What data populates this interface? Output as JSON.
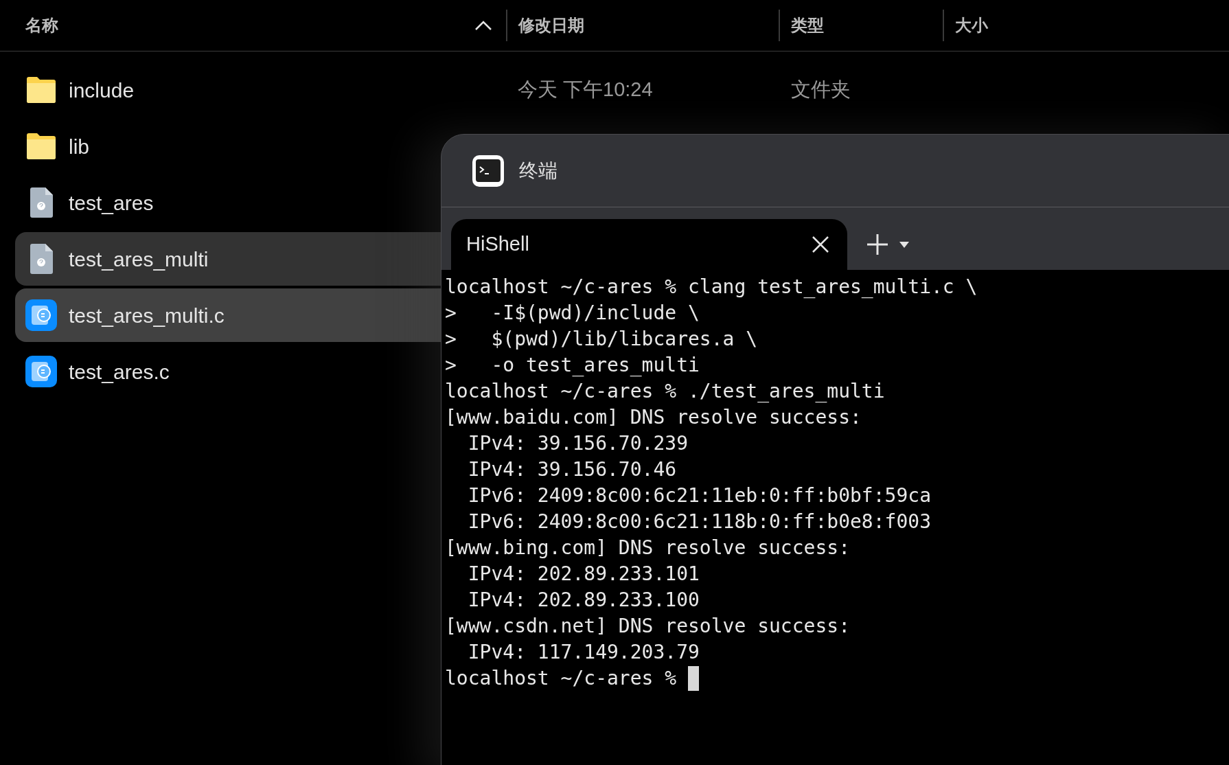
{
  "file_list": {
    "columns": [
      {
        "label": "名称",
        "sorted": true
      },
      {
        "label": "修改日期",
        "sorted": false
      },
      {
        "label": "类型",
        "sorted": false
      },
      {
        "label": "大小",
        "sorted": false
      }
    ],
    "rows": [
      {
        "name": "include",
        "kind": "folder",
        "selected": false,
        "modified": "今天 下午10:24",
        "type": "文件夹"
      },
      {
        "name": "lib",
        "kind": "folder",
        "selected": false
      },
      {
        "name": "test_ares",
        "kind": "binary",
        "selected": false
      },
      {
        "name": "test_ares_multi",
        "kind": "binary",
        "selected": true
      },
      {
        "name": "test_ares_multi.c",
        "kind": "source",
        "selected": true
      },
      {
        "name": "test_ares.c",
        "kind": "source",
        "selected": false
      }
    ]
  },
  "terminal": {
    "title": "终端",
    "tabs": [
      {
        "label": "HiShell",
        "selected": true
      }
    ],
    "lines": [
      "localhost ~/c-ares % clang test_ares_multi.c \\",
      ">   -I$(pwd)/include \\",
      ">   $(pwd)/lib/libcares.a \\",
      ">   -o test_ares_multi",
      "localhost ~/c-ares % ./test_ares_multi",
      "[www.baidu.com] DNS resolve success:",
      "  IPv4: 39.156.70.239",
      "  IPv4: 39.156.70.46",
      "  IPv6: 2409:8c00:6c21:11eb:0:ff:b0bf:59ca",
      "  IPv6: 2409:8c00:6c21:118b:0:ff:b0e8:f003",
      "[www.bing.com] DNS resolve success:",
      "  IPv4: 202.89.233.101",
      "  IPv4: 202.89.233.100",
      "[www.csdn.net] DNS resolve success:",
      "  IPv4: 117.149.203.79",
      "localhost ~/c-ares % "
    ],
    "cursor": true
  }
}
